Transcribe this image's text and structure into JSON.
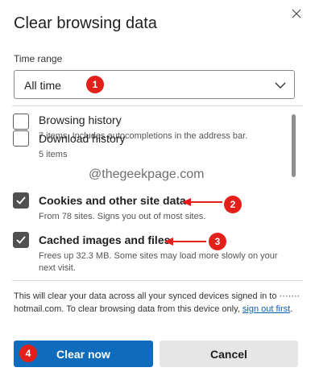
{
  "dialog": {
    "title": "Clear browsing data",
    "close_icon": "close-icon"
  },
  "time_range": {
    "label": "Time range",
    "value": "All time",
    "chevron_icon": "chevron-down-icon"
  },
  "items": [
    {
      "label": "Browsing history",
      "desc": "7 items. Includes autocompletions in the address bar.",
      "checked": false
    },
    {
      "label": "Download history",
      "desc": "5 items",
      "checked": false
    },
    {
      "label": "Cookies and other site data",
      "desc": "From 78 sites. Signs you out of most sites.",
      "checked": true
    },
    {
      "label": "Cached images and files",
      "desc": "Frees up 32.3 MB. Some sites may load more slowly on your next visit.",
      "checked": true
    }
  ],
  "watermark": "@thegeekpage.com",
  "annotations": {
    "badge1": "1",
    "badge2": "2",
    "badge3": "3",
    "badge4": "4",
    "color": "#e4201b"
  },
  "footer": {
    "text_before": "This will clear your data across all your synced devices signed in to ",
    "account": "······· hotmail.com",
    "text_middle": ". To clear browsing data from this device only, ",
    "link": "sign out first",
    "text_after": "."
  },
  "buttons": {
    "primary": "Clear now",
    "secondary": "Cancel"
  },
  "colors": {
    "primary": "#0f6cbd",
    "secondary": "#e6e6e6",
    "checkbox_checked": "#505050",
    "link": "#0f5fb5"
  }
}
